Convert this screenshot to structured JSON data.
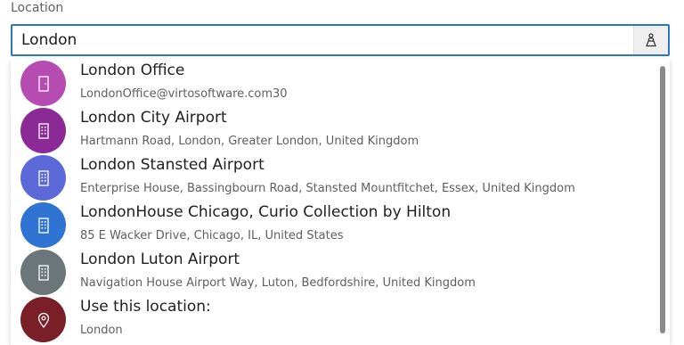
{
  "field": {
    "label": "Location",
    "value": "London"
  },
  "icons": {
    "input_button": "person-location-icon"
  },
  "items": [
    {
      "title": "London Office",
      "subtitle": "LondonOffice@virtosoftware.com30",
      "icon": "door-icon",
      "color": "#b64cb2"
    },
    {
      "title": "London City Airport",
      "subtitle": "Hartmann Road, London, Greater London, United Kingdom",
      "icon": "building-icon",
      "color": "#8b2a95"
    },
    {
      "title": "London Stansted Airport",
      "subtitle": "Enterprise House, Bassingbourn Road, Stansted Mountfitchet, Essex, United Kingdom",
      "icon": "building-icon",
      "color": "#5b6ad8"
    },
    {
      "title": "LondonHouse Chicago, Curio Collection by Hilton",
      "subtitle": "85 E Wacker Drive, Chicago, IL, United States",
      "icon": "building-icon",
      "color": "#2f73d3"
    },
    {
      "title": "London Luton Airport",
      "subtitle": "Navigation House Airport Way, Luton, Bedfordshire, United Kingdom",
      "icon": "building-icon",
      "color": "#6b767a"
    },
    {
      "title": "Use this location:",
      "subtitle": "London",
      "icon": "map-pin-icon",
      "color": "#7a1f28"
    }
  ]
}
